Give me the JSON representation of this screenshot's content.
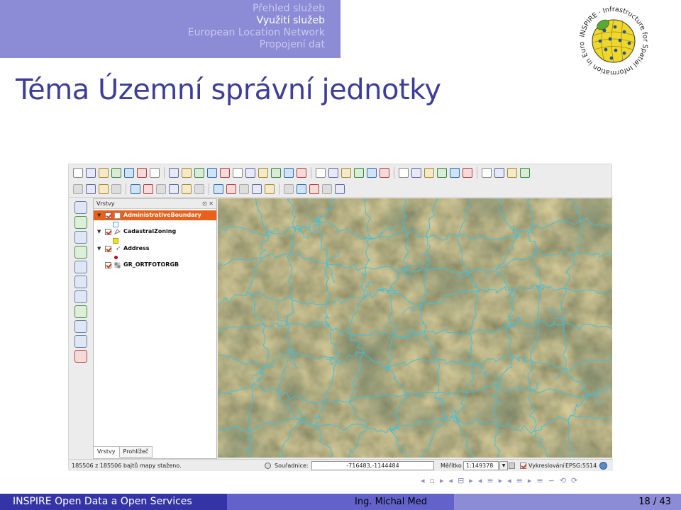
{
  "header": {
    "nav_items": [
      "Přehled služeb",
      "Využití služeb",
      "European Location Network",
      "Propojení dat"
    ],
    "active_index": 1,
    "frame_title": "Téma Územní správní jednotky"
  },
  "logo": {
    "text": "INSPIRE · Infrastructure for Spatial Information in Europe",
    "icon": "inspire-logo"
  },
  "qgis": {
    "layers_panel": {
      "title": "Vrstvy",
      "controls": "⊡ ✕",
      "layers": [
        {
          "name": "AdministrativeBoundary",
          "checked": true,
          "selected": true,
          "expanded": true
        },
        {
          "name": "CadastralZoning",
          "checked": true,
          "selected": false,
          "expanded": true
        },
        {
          "name": "Address",
          "checked": true,
          "selected": false,
          "expanded": true
        },
        {
          "name": "GR_ORTFOTORGB",
          "checked": true,
          "selected": false,
          "expanded": false
        }
      ],
      "tabs": [
        "Vrstvy",
        "Prohlížeč"
      ],
      "active_tab": 0
    },
    "status_bar": {
      "message": "185506 z 185506 bajtů mapy staženo.",
      "coord_label": "Souřadnice:",
      "coord_value": "-716483,-1144484",
      "scale_label": "Měřítko",
      "scale_value": "1:149378",
      "render_label": "Vykreslování",
      "render_checked": true,
      "crs": "EPSG:5514"
    },
    "map": {
      "boundary_color": "#3fc0dd",
      "background": "orthophoto"
    }
  },
  "beamer_nav": [
    "◂",
    "▫",
    "▸",
    "◂",
    "⊟",
    "▸",
    "◂",
    "≡",
    "▸",
    "◂",
    "≡",
    "▸",
    "≡",
    "∽",
    "⟲",
    "⟳"
  ],
  "footer": {
    "left": "INSPIRE Open Data a Open Services",
    "center": "Ing. Michal Med",
    "right": "18 / 43"
  }
}
